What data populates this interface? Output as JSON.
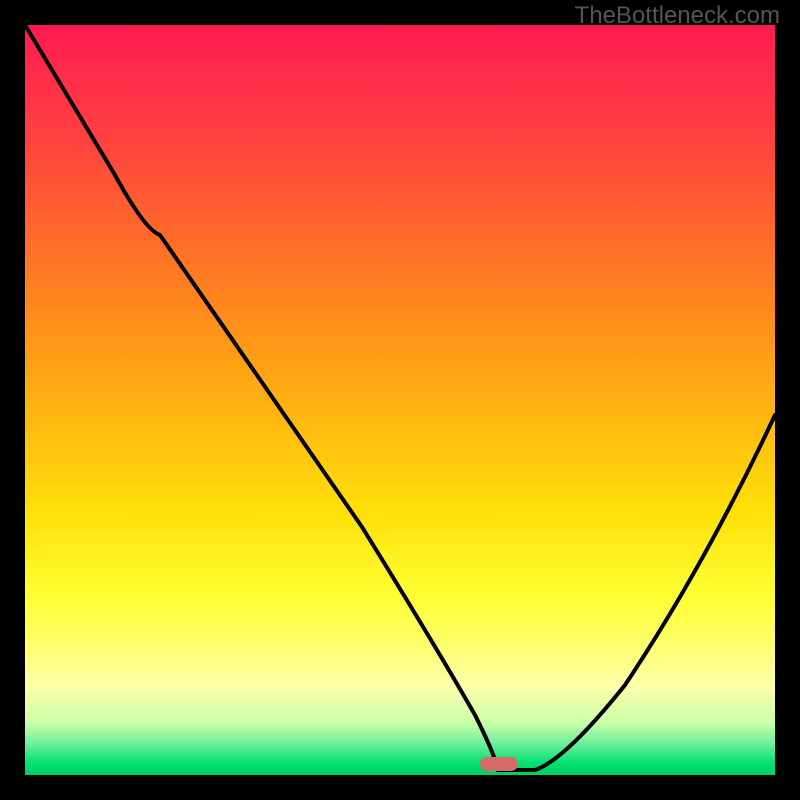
{
  "watermark": "TheBottleneck.com",
  "chart_data": {
    "type": "line",
    "title": "",
    "xlabel": "",
    "ylabel": "",
    "xlim": [
      0,
      100
    ],
    "ylim": [
      0,
      100
    ],
    "series": [
      {
        "name": "bottleneck-curve",
        "x": [
          0,
          12,
          18,
          30,
          45,
          55,
          60,
          63,
          66,
          68,
          72,
          80,
          90,
          100
        ],
        "y": [
          100,
          80,
          72,
          55,
          33,
          18,
          8,
          2,
          0,
          0,
          2,
          12,
          30,
          48
        ]
      }
    ],
    "marker": {
      "x": 63,
      "y": 0
    },
    "gradient_zones": [
      {
        "pct": 0,
        "color": "#ff1a4d",
        "meaning": "worst"
      },
      {
        "pct": 50,
        "color": "#ffc010",
        "meaning": "moderate"
      },
      {
        "pct": 100,
        "color": "#00d060",
        "meaning": "optimal"
      }
    ]
  }
}
